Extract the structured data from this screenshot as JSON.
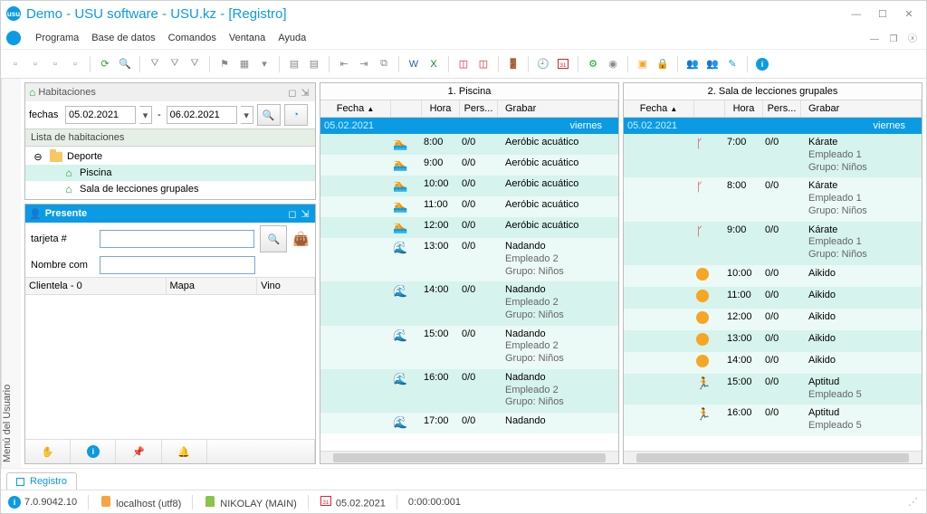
{
  "window": {
    "title": "Demo - USU software - USU.kz - [Registro]"
  },
  "menu": {
    "items": [
      "Programa",
      "Base de datos",
      "Comandos",
      "Ventana",
      "Ayuda"
    ]
  },
  "side_tab": "Menú del Usuario",
  "rooms_panel": {
    "title": "Habitaciones",
    "dates_label": "fechas",
    "date_from": "05.02.2021",
    "date_to": "06.02.2021",
    "list_header": "Lista de habitaciones",
    "tree": {
      "root": "Deporte",
      "children": [
        "Piscina",
        "Sala de lecciones grupales"
      ]
    }
  },
  "present_panel": {
    "title": "Presente",
    "card_label": "tarjeta #",
    "name_label": "Nombre com",
    "card_value": "",
    "name_value": "",
    "cols": {
      "clients": "Clientela - 0",
      "map": "Mapa",
      "wine": "Vino"
    }
  },
  "schedules": [
    {
      "title": "1. Piscina",
      "cols": {
        "date": "Fecha",
        "hour": "Hora",
        "pers": "Pers...",
        "rec": "Grabar"
      },
      "date": "05.02.2021",
      "dayname": "viernes",
      "rows": [
        {
          "icon": "swim",
          "hour": "8:00",
          "ppl": "0/0",
          "lines": [
            "Aeróbic acuático"
          ]
        },
        {
          "icon": "swim",
          "hour": "9:00",
          "ppl": "0/0",
          "lines": [
            "Aeróbic acuático"
          ]
        },
        {
          "icon": "swim",
          "hour": "10:00",
          "ppl": "0/0",
          "lines": [
            "Aeróbic acuático"
          ]
        },
        {
          "icon": "swim",
          "hour": "11:00",
          "ppl": "0/0",
          "lines": [
            "Aeróbic acuático"
          ]
        },
        {
          "icon": "swim",
          "hour": "12:00",
          "ppl": "0/0",
          "lines": [
            "Aeróbic acuático"
          ]
        },
        {
          "icon": "wave",
          "hour": "13:00",
          "ppl": "0/0",
          "lines": [
            "Nadando",
            "Empleado 2",
            "Grupo: Niños"
          ]
        },
        {
          "icon": "wave",
          "hour": "14:00",
          "ppl": "0/0",
          "lines": [
            "Nadando",
            "Empleado 2",
            "Grupo: Niños"
          ]
        },
        {
          "icon": "wave",
          "hour": "15:00",
          "ppl": "0/0",
          "lines": [
            "Nadando",
            "Empleado 2",
            "Grupo: Niños"
          ]
        },
        {
          "icon": "wave",
          "hour": "16:00",
          "ppl": "0/0",
          "lines": [
            "Nadando",
            "Empleado 2",
            "Grupo: Niños"
          ]
        },
        {
          "icon": "wave",
          "hour": "17:00",
          "ppl": "0/0",
          "lines": [
            "Nadando"
          ]
        }
      ]
    },
    {
      "title": "2. Sala de lecciones grupales",
      "cols": {
        "date": "Fecha",
        "hour": "Hora",
        "pers": "Pers...",
        "rec": "Grabar"
      },
      "date": "05.02.2021",
      "dayname": "viernes",
      "rows": [
        {
          "icon": "karate",
          "hour": "7:00",
          "ppl": "0/0",
          "lines": [
            "Kárate",
            "Empleado 1",
            "Grupo: Niños"
          ]
        },
        {
          "icon": "karate",
          "hour": "8:00",
          "ppl": "0/0",
          "lines": [
            "Kárate",
            "Empleado 1",
            "Grupo: Niños"
          ]
        },
        {
          "icon": "karate",
          "hour": "9:00",
          "ppl": "0/0",
          "lines": [
            "Kárate",
            "Empleado 1",
            "Grupo: Niños"
          ]
        },
        {
          "icon": "aikido",
          "hour": "10:00",
          "ppl": "0/0",
          "lines": [
            "Aikido"
          ]
        },
        {
          "icon": "aikido",
          "hour": "11:00",
          "ppl": "0/0",
          "lines": [
            "Aikido"
          ]
        },
        {
          "icon": "aikido",
          "hour": "12:00",
          "ppl": "0/0",
          "lines": [
            "Aikido"
          ]
        },
        {
          "icon": "aikido",
          "hour": "13:00",
          "ppl": "0/0",
          "lines": [
            "Aikido"
          ]
        },
        {
          "icon": "aikido",
          "hour": "14:00",
          "ppl": "0/0",
          "lines": [
            "Aikido"
          ]
        },
        {
          "icon": "run",
          "hour": "15:00",
          "ppl": "0/0",
          "lines": [
            "Aptitud",
            "Empleado 5"
          ]
        },
        {
          "icon": "run",
          "hour": "16:00",
          "ppl": "0/0",
          "lines": [
            "Aptitud",
            "Empleado 5"
          ]
        }
      ]
    }
  ],
  "tab": "Registro",
  "status": {
    "version": "7.0.9042.10",
    "host": "localhost (utf8)",
    "user": "NIKOLAY (MAIN)",
    "date": "05.02.2021",
    "timer": "0:00:00:001"
  }
}
